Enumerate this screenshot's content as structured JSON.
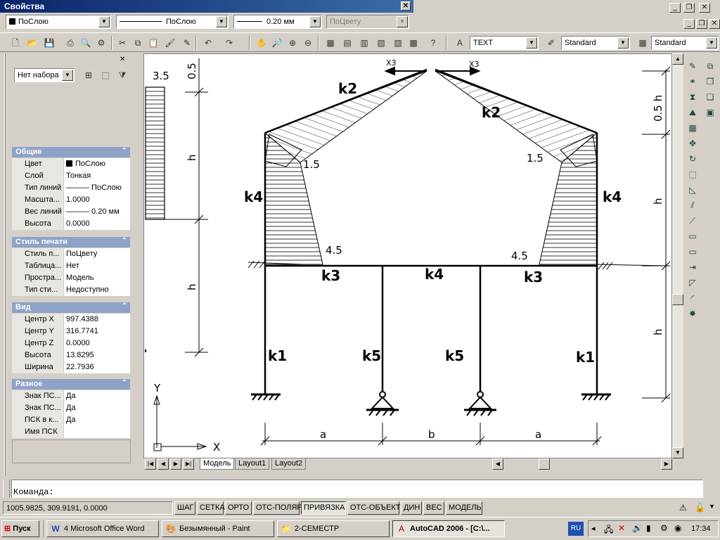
{
  "properties_window": {
    "title": "Свойства",
    "color_combo": "ПоСлою",
    "linetype_combo": "ПоСлою",
    "lineweight_combo": "0.20 мм",
    "plotstyle_combo": "ПоЦвету"
  },
  "toolbar": {
    "text_style": "TEXT",
    "dim_style": "Standard",
    "table_style": "Standard"
  },
  "panel": {
    "selection_combo": "Нет набора",
    "sections": [
      {
        "title": "Общие",
        "rows": [
          {
            "key": "Цвет",
            "value": "ПоСлою",
            "swatch": true
          },
          {
            "key": "Слой",
            "value": "Тонкая"
          },
          {
            "key": "Тип линий",
            "value": "——— ПоСлою"
          },
          {
            "key": "Масшта...",
            "value": "1.0000"
          },
          {
            "key": "Вес линий",
            "value": "——— 0.20 мм"
          },
          {
            "key": "Высота",
            "value": "0.0000"
          }
        ]
      },
      {
        "title": "Стиль печати",
        "rows": [
          {
            "key": "Стиль п...",
            "value": "ПоЦвету"
          },
          {
            "key": "Таблица...",
            "value": "Нет"
          },
          {
            "key": "Простра...",
            "value": "Модель"
          },
          {
            "key": "Тип сти...",
            "value": "Недоступно"
          }
        ]
      },
      {
        "title": "Вид",
        "rows": [
          {
            "key": "Центр X",
            "value": "997.4388"
          },
          {
            "key": "Центр Y",
            "value": "316.7741"
          },
          {
            "key": "Центр Z",
            "value": "0.0000"
          },
          {
            "key": "Высота",
            "value": "13.8295"
          },
          {
            "key": "Ширина",
            "value": "22.7936"
          }
        ]
      },
      {
        "title": "Разное",
        "rows": [
          {
            "key": "Знак ПС...",
            "value": "Да"
          },
          {
            "key": "Знак ПС...",
            "value": "Да"
          },
          {
            "key": "ПСК в к...",
            "value": "Да"
          },
          {
            "key": "Имя ПСК",
            "value": ""
          }
        ]
      }
    ]
  },
  "drawing": {
    "labels": {
      "k2_left": "k2",
      "k2_right": "k2",
      "k4_left": "k4",
      "k4_right": "k4",
      "k4_mid": "k4",
      "k3_left": "k3",
      "k3_right": "k3",
      "k1_left": "k1",
      "k1_right": "k1",
      "k5_left": "k5",
      "k5_right": "k5",
      "x3_left": "X3",
      "x3_right": "X3",
      "v15_left": "1.5",
      "v15_right": "1.5",
      "v45_left": "4.5",
      "v45_right": "4.5",
      "v35": "3.5",
      "dim_a_left": "a",
      "dim_b": "b",
      "dim_a_right": "a",
      "dim_05_left": "0.5",
      "dim_h_left_1": "h",
      "dim_h_left_2": "h",
      "dim_05h_right": "0.5 h",
      "dim_h_right_1": "h",
      "dim_h_right_2": "h",
      "axis_y": "Y",
      "axis_x": "X"
    }
  },
  "tabs": [
    "Модель",
    "Layout1",
    "Layout2"
  ],
  "command": {
    "prompt": "Команда:"
  },
  "status": {
    "coords": "1005.9825, 309.9191, 0.0000",
    "buttons": [
      "ШАГ",
      "СЕТКА",
      "ОРТО",
      "ОТС-ПОЛЯР",
      "ПРИВЯЗКА",
      "ОТС-ОБЪЕКТ",
      "ДИН",
      "ВЕС",
      "МОДЕЛЬ"
    ]
  },
  "taskbar": {
    "start": "Пуск",
    "tasks": [
      "4 Microsoft Office Word",
      "Безымянный - Paint",
      "2-СЕМЕСТР",
      "AutoCAD 2006 - [C:\\..."
    ],
    "lang": "RU",
    "clock": "17:34"
  }
}
